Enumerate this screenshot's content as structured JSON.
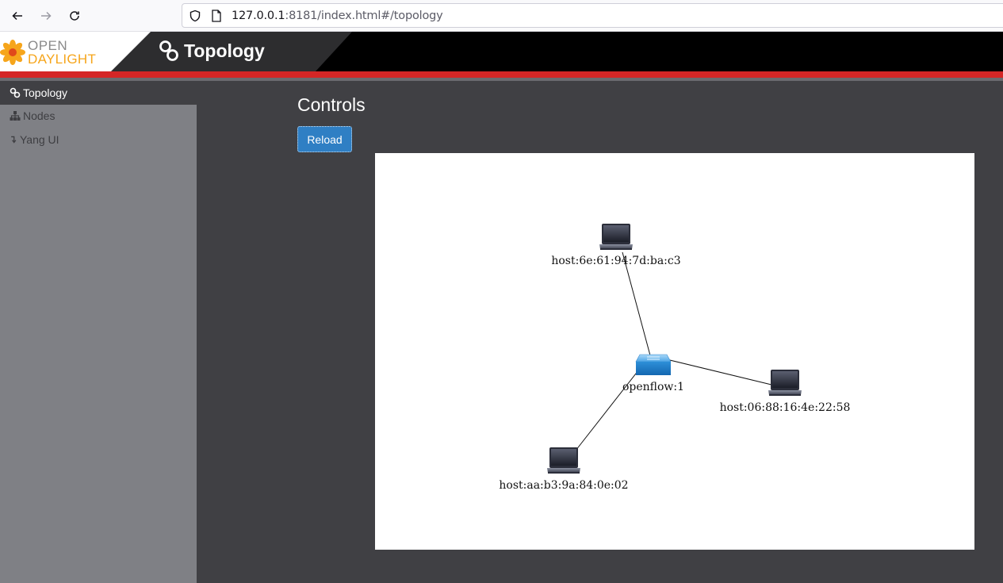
{
  "browser": {
    "url_host": "127.0.0.1",
    "url_rest": ":8181/index.html#/topology"
  },
  "header": {
    "logo_line1": "OPEN",
    "logo_line2": "DAYLIGHT",
    "title": "Topology"
  },
  "sidebar": {
    "items": [
      {
        "label": "Topology",
        "icon": "link-icon",
        "active": true
      },
      {
        "label": "Nodes",
        "icon": "sitemap-icon",
        "active": false
      },
      {
        "label": "Yang UI",
        "icon": "arrow-down-icon",
        "active": false
      }
    ]
  },
  "main": {
    "controls_title": "Controls",
    "reload_label": "Reload"
  },
  "topology": {
    "nodes": [
      {
        "id": "switch",
        "label": "openflow:1",
        "type": "switch"
      },
      {
        "id": "h1",
        "label": "host:6e:61:94:7d:ba:c3",
        "type": "host"
      },
      {
        "id": "h2",
        "label": "host:06:88:16:4e:22:58",
        "type": "host"
      },
      {
        "id": "h3",
        "label": "host:aa:b3:9a:84:0e:02",
        "type": "host"
      }
    ],
    "links": [
      [
        "h1",
        "switch"
      ],
      [
        "h2",
        "switch"
      ],
      [
        "h3",
        "switch"
      ]
    ]
  },
  "colors": {
    "accent_red": "#d42626",
    "brand_orange": "#f6a51b",
    "button_blue": "#2f7fc4"
  }
}
